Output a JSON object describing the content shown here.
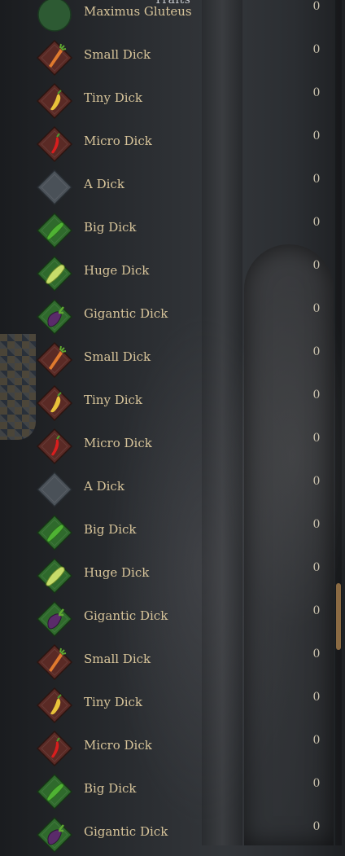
{
  "panel": {
    "title": "Traits"
  },
  "rows": [
    {
      "label": "Maximus Gluteus",
      "value": "0",
      "icon": "round-green-icon"
    },
    {
      "label": "Small Dick",
      "value": "0",
      "icon": "carrot-icon"
    },
    {
      "label": "Tiny Dick",
      "value": "0",
      "icon": "yellow-pepper-icon"
    },
    {
      "label": "Micro Dick",
      "value": "0",
      "icon": "red-chili-icon"
    },
    {
      "label": "A Dick",
      "value": "0",
      "icon": "blank-diamond-icon"
    },
    {
      "label": "Big Dick",
      "value": "0",
      "icon": "cucumber-icon"
    },
    {
      "label": "Huge Dick",
      "value": "0",
      "icon": "zucchini-icon"
    },
    {
      "label": "Gigantic Dick",
      "value": "0",
      "icon": "eggplant-icon"
    },
    {
      "label": "Small Dick",
      "value": "0",
      "icon": "carrot-icon"
    },
    {
      "label": "Tiny Dick",
      "value": "0",
      "icon": "yellow-pepper-icon"
    },
    {
      "label": "Micro Dick",
      "value": "0",
      "icon": "red-chili-icon"
    },
    {
      "label": "A Dick",
      "value": "0",
      "icon": "blank-diamond-icon"
    },
    {
      "label": "Big Dick",
      "value": "0",
      "icon": "cucumber-icon"
    },
    {
      "label": "Huge Dick",
      "value": "0",
      "icon": "zucchini-icon"
    },
    {
      "label": "Gigantic Dick",
      "value": "0",
      "icon": "eggplant-icon"
    },
    {
      "label": "Small Dick",
      "value": "0",
      "icon": "carrot-icon"
    },
    {
      "label": "Tiny Dick",
      "value": "0",
      "icon": "yellow-pepper-icon"
    },
    {
      "label": "Micro Dick",
      "value": "0",
      "icon": "red-chili-icon"
    },
    {
      "label": "Big Dick",
      "value": "0",
      "icon": "cucumber-icon"
    },
    {
      "label": "Gigantic Dick",
      "value": "0",
      "icon": "eggplant-icon"
    }
  ],
  "colors": {
    "label": "#d7c49a",
    "value": "#c9c1ad",
    "red_diamond": "#5a2a25",
    "green_diamond": "#2f6a2c",
    "grey_diamond": "#4a5158",
    "scroll_thumb": "#8a6a43"
  }
}
